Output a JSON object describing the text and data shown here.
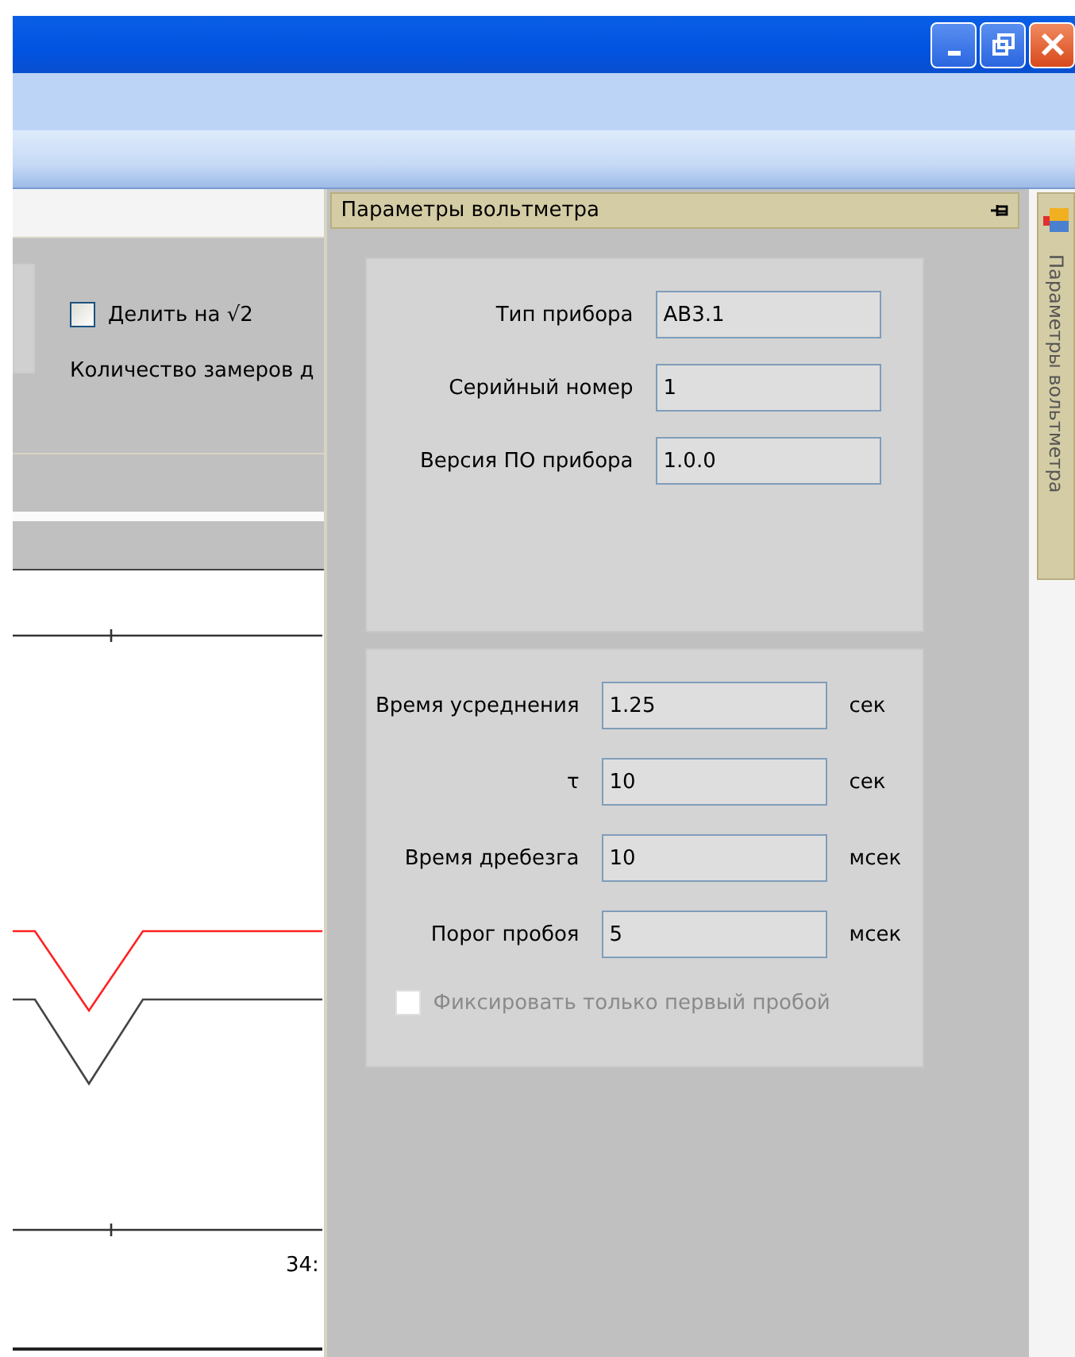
{
  "left_panel": {
    "divide_checkbox": {
      "label": "Делить на √2",
      "checked": false
    },
    "count_label": "Количество замеров д",
    "chart_label": "34:"
  },
  "dock_panel": {
    "title": "Параметры вольтметра",
    "device_fields": [
      {
        "label": "Тип прибора",
        "value": "АВ3.1"
      },
      {
        "label": "Серийный номер",
        "value": "1"
      },
      {
        "label": "Версия ПО прибора",
        "value": "1.0.0"
      }
    ],
    "timing_fields": [
      {
        "label": "Время усреднения",
        "value": "1.25",
        "unit": "сек"
      },
      {
        "label": "τ",
        "value": "10",
        "unit": "сек"
      },
      {
        "label": "Время дребезга",
        "value": "10",
        "unit": "мсек"
      },
      {
        "label": "Порог пробоя",
        "value": "5",
        "unit": "мсек"
      }
    ],
    "first_breakdown_checkbox": {
      "label": "Фиксировать только первый пробой",
      "checked": false,
      "disabled": true
    }
  },
  "side_tab": {
    "label": "Параметры вольтметра"
  }
}
